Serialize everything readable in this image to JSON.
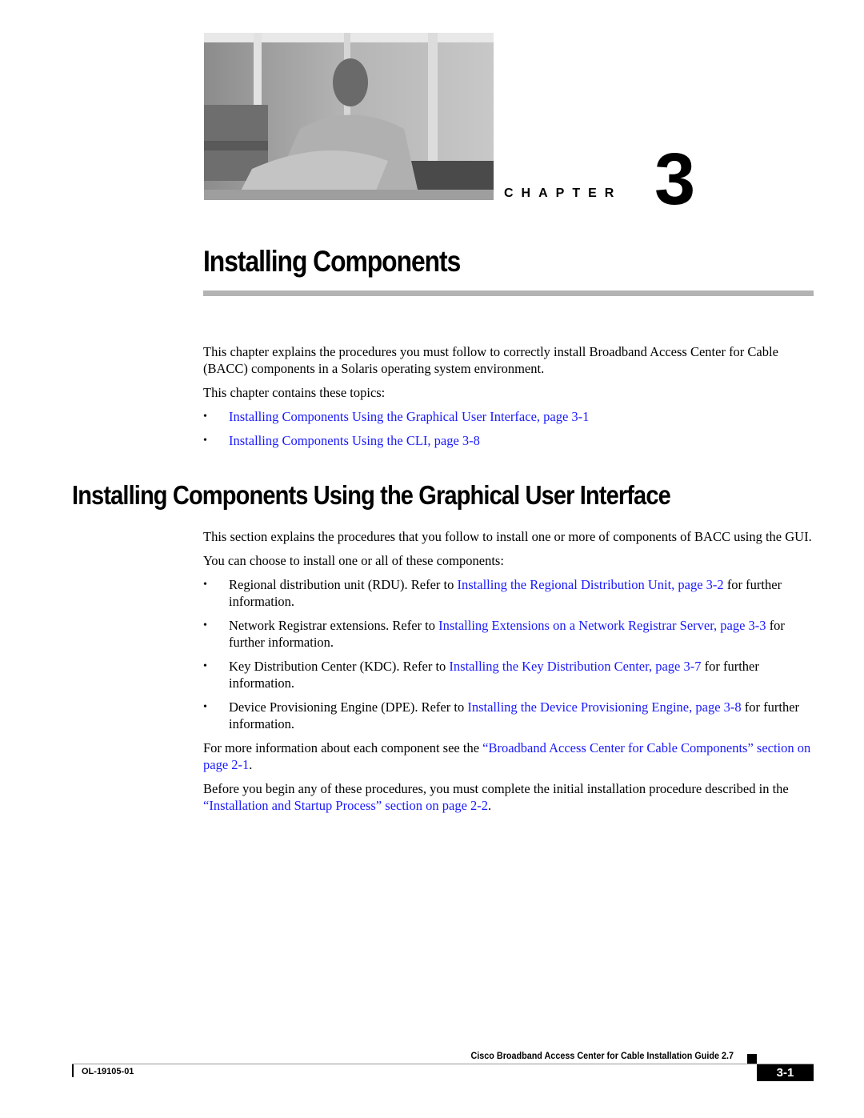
{
  "header": {
    "photo_alt": "Grayscale photo of a man seated on a couch",
    "chapter_label": "CHAPTER",
    "chapter_number": "3",
    "chapter_title": "Installing Components"
  },
  "intro": {
    "paragraph1": "This chapter explains the procedures you must follow to correctly install Broadband Access Center for Cable (BACC) components in a Solaris operating system environment.",
    "paragraph2": "This chapter contains these topics:",
    "topics": [
      {
        "bullet": "•",
        "link": "Installing Components Using the Graphical User Interface, page 3-1"
      },
      {
        "bullet": "•",
        "link": "Installing Components Using the CLI, page 3-8"
      }
    ]
  },
  "section": {
    "heading": "Installing Components Using the Graphical User Interface",
    "paragraph1": "This section explains the procedures that you follow to install one or more of components of BACC using the GUI.",
    "paragraph2": "You can choose to install one or all of these components:",
    "components": [
      {
        "bullet": "•",
        "text": "Regional distribution unit (RDU). Refer to ",
        "link": "Installing the Regional Distribution Unit, page 3-2",
        "after": " for further information."
      },
      {
        "bullet": "•",
        "text": "Network Registrar extensions. Refer to ",
        "link": "Installing Extensions on a Network Registrar Server, page 3-3",
        "after": " for further information."
      },
      {
        "bullet": "•",
        "text": "Key Distribution Center (KDC). Refer to ",
        "link": "Installing the Key Distribution Center, page 3-7",
        "after": " for further information."
      },
      {
        "bullet": "•",
        "text": "Device Provisioning Engine (DPE). Refer to ",
        "link": "Installing the Device Provisioning Engine, page 3-8",
        "after": " for further information."
      }
    ],
    "paragraph3": {
      "text": "For more information about each component see the ",
      "link": "“Broadband Access Center for Cable Components” section on page 2-1",
      "after": "."
    },
    "paragraph4": {
      "text": "Before you begin any of these procedures, you must complete the initial installation procedure described in the ",
      "link": "“Installation and Startup Process” section on page 2-2",
      "after": "."
    }
  },
  "footer": {
    "guide_title": "Cisco Broadband Access Center for Cable Installation Guide 2.7",
    "doc_number": "OL-19105-01",
    "page_number": "3-1"
  },
  "colors": {
    "link": "#1a1aff",
    "rule": "#b3b3b3"
  }
}
